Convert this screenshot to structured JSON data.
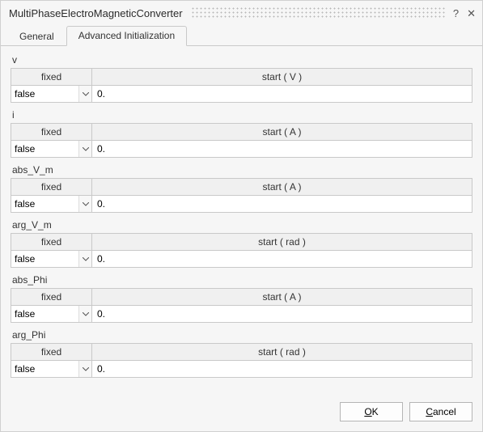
{
  "title": "MultiPhaseElectroMagneticConverter",
  "tabs": {
    "general": "General",
    "advanced": "Advanced Initialization"
  },
  "headers": {
    "fixed": "fixed"
  },
  "fields": [
    {
      "name": "v",
      "start_header": "start ( V )",
      "fixed": "false",
      "start": "0."
    },
    {
      "name": "i",
      "start_header": "start ( A )",
      "fixed": "false",
      "start": "0."
    },
    {
      "name": "abs_V_m",
      "start_header": "start ( A )",
      "fixed": "false",
      "start": "0."
    },
    {
      "name": "arg_V_m",
      "start_header": "start ( rad )",
      "fixed": "false",
      "start": "0."
    },
    {
      "name": "abs_Phi",
      "start_header": "start ( A )",
      "fixed": "false",
      "start": "0."
    },
    {
      "name": "arg_Phi",
      "start_header": "start ( rad )",
      "fixed": "false",
      "start": "0."
    }
  ],
  "fixed_options": [
    "false",
    "true"
  ],
  "buttons": {
    "ok": "OK",
    "cancel": "Cancel"
  }
}
